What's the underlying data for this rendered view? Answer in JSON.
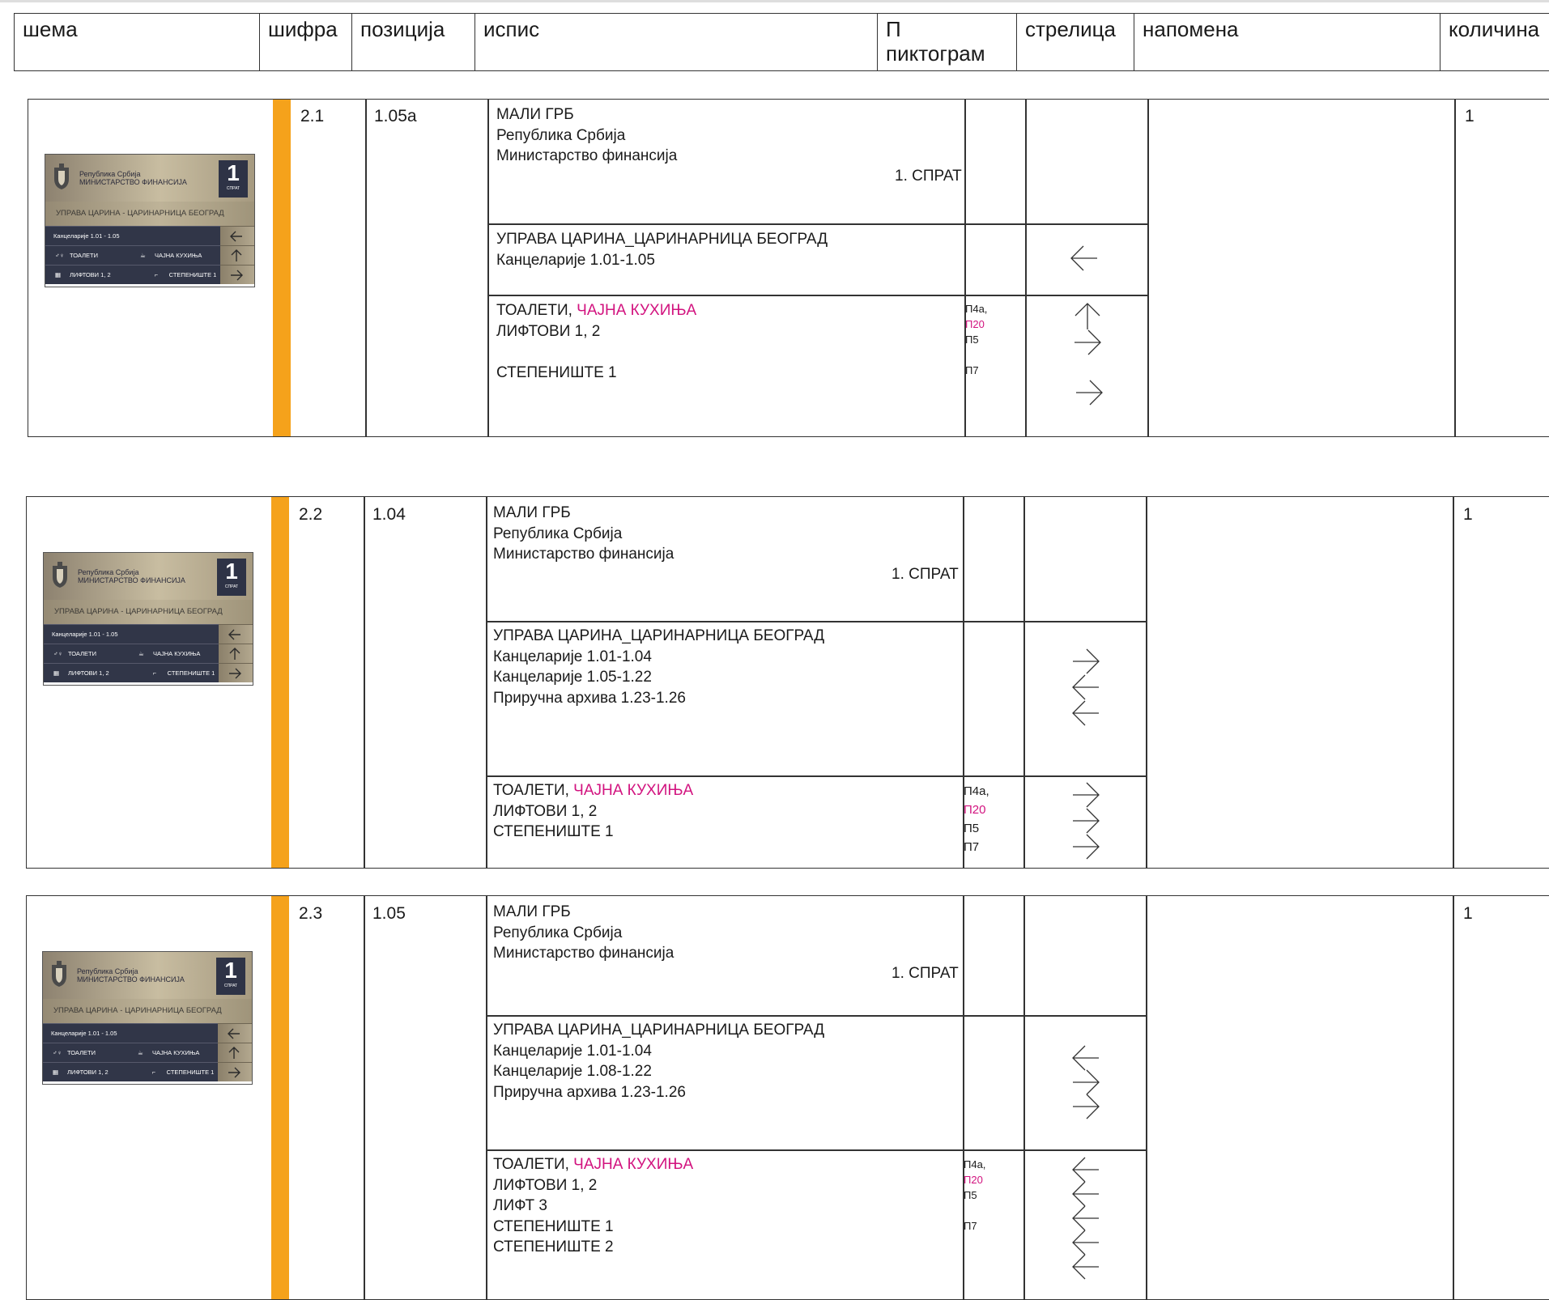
{
  "header": {
    "col_schema": "шема",
    "col_code": "шифра",
    "col_position": "позиција",
    "col_text": "испис",
    "col_picto_1": "П",
    "col_picto_2": "пиктограм",
    "col_arrow": "стрелица",
    "col_note": "напомена",
    "col_qty": "количина"
  },
  "sign": {
    "republic": "Република Србија",
    "ministry": "МИНИСТАРСТВО ФИНАНСИЈА",
    "floor_number": "1",
    "floor_word": "СПРАТ",
    "band": "УПРАВА ЦАРИНА - ЦАРИНАРНИЦА БЕОГРАД",
    "row_offices": "Канцеларије 1.01 - 1.05",
    "row_toilets": "ТОАЛЕТИ",
    "row_kitchen": "ЧАЈНА КУХИЊА",
    "row_lifts": "ЛИФТОВИ 1, 2",
    "row_stairs": "СТЕПЕНИШТЕ 1",
    "crest_icon": "coat-of-arms-icon",
    "colors": {
      "gold": "#c8bda1",
      "navy": "#313648",
      "orange": "#f5a21b",
      "magenta": "#d2137f"
    }
  },
  "rows": [
    {
      "code": "2.1",
      "position": "1.05а",
      "qty": "1",
      "s1": {
        "l1": "МАЛИ ГРБ",
        "l2": "Република Србија",
        "l3": "Министарство финансија",
        "floor": "1. СПРАТ"
      },
      "s2": {
        "l1": " УПРАВА ЦАРИНА_ЦАРИНАРНИЦА БЕОГРАД",
        "l2": "Канцеларије 1.01-1.05",
        "arrows": [
          "left"
        ]
      },
      "s3": {
        "toilets": "ТОАЛЕТИ, ",
        "kitchen": "ЧАЈНА КУХИЊА",
        "l2": "ЛИФТОВИ 1, 2",
        "l3": "",
        "l4": "СТЕПЕНИШТЕ 1",
        "p1": "П4а, ",
        "p1b": "П20",
        "p2": "П5",
        "p3": "",
        "p4": "П7",
        "arrows": [
          "up",
          "right",
          "right"
        ]
      }
    },
    {
      "code": "2.2",
      "position": "1.04",
      "qty": "1",
      "s1": {
        "l1": "МАЛИ ГРБ",
        "l2": "Република Србија",
        "l3": "Министарство финансија",
        "floor": "1. СПРАТ"
      },
      "s2": {
        "l1": " УПРАВА ЦАРИНА_ЦАРИНАРНИЦА БЕОГРАД",
        "l2": "Канцеларије 1.01-1.04",
        "l3": "Канцеларије 1.05-1.22",
        "l4": "Приручна архива 1.23-1.26",
        "arrows": [
          "right",
          "left",
          "left"
        ]
      },
      "s3": {
        "toilets": "ТОАЛЕТИ, ",
        "kitchen": "ЧАЈНА КУХИЊА",
        "l2": "ЛИФТОВИ 1, 2",
        "l3": "СТЕПЕНИШТЕ 1",
        "p1": "П4а, ",
        "p1b": "П20",
        "p2": "П5",
        "p3": "П7",
        "arrows": [
          "right",
          "right",
          "right"
        ]
      }
    },
    {
      "code": "2.3",
      "position": "1.05",
      "qty": "1",
      "s1": {
        "l1": "МАЛИ ГРБ",
        "l2": "Република Србија",
        "l3": "Министарство финансија",
        "floor": "1. СПРАТ"
      },
      "s2": {
        "l1": " УПРАВА ЦАРИНА_ЦАРИНАРНИЦА БЕОГРАД",
        "l2": "Канцеларије 1.01-1.04",
        "l3": "Канцеларије 1.08-1.22",
        "l4": "Приручна архива 1.23-1.26",
        "arrows": [
          "left",
          "right",
          "right"
        ]
      },
      "s3": {
        "toilets": "ТОАЛЕТИ, ",
        "kitchen": "ЧАЈНА КУХИЊА",
        "l2": "ЛИФТОВИ 1, 2",
        "l3": "ЛИФТ 3",
        "l4": "СТЕПЕНИШТЕ 1",
        "l5": "СТЕПЕНИШТЕ 2",
        "p1": "П4а, ",
        "p1b": "П20",
        "p2": "П5",
        "p3": "",
        "p4": "П7",
        "arrows": [
          "left",
          "left",
          "left",
          "left",
          "left"
        ]
      }
    }
  ]
}
